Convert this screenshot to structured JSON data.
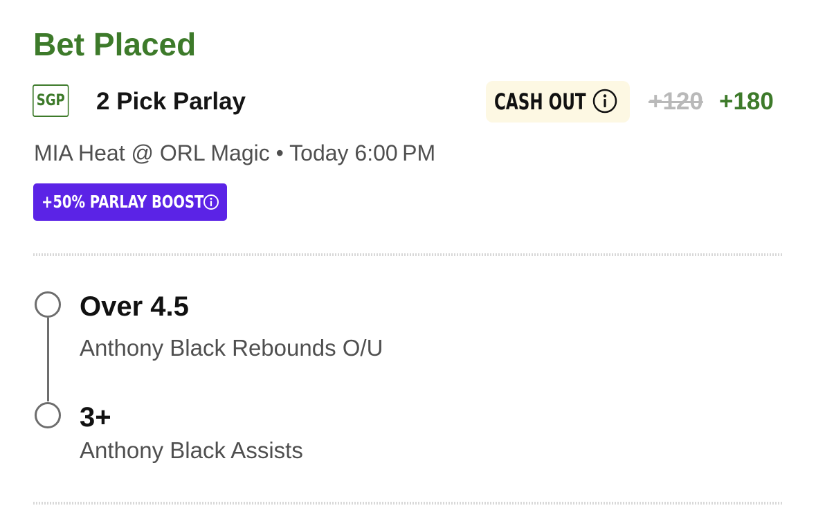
{
  "header": {
    "status": "Bet Placed"
  },
  "bet": {
    "badge": "SGP",
    "title": "2 Pick Parlay",
    "cash_out_label": "CASH OUT",
    "old_odds": "+120",
    "new_odds": "+180",
    "game": "MIA Heat @ ORL Magic • Today 6:00 PM",
    "boost_label": "+50% PARLAY BOOST"
  },
  "legs": [
    {
      "selection": "Over 4.5",
      "market": "Anthony Black Rebounds O/U"
    },
    {
      "selection": "3+",
      "market": "Anthony Black Assists"
    }
  ],
  "colors": {
    "accent_green": "#3d7a2a",
    "boost_purple": "#5b23e6",
    "cashout_bg": "#fdf8e3",
    "old_odds_gray": "#b9b9b9"
  },
  "icons": {
    "cash_out_info": "info-icon",
    "boost_info": "info-icon",
    "leg_marker": "circle-outline-icon"
  }
}
